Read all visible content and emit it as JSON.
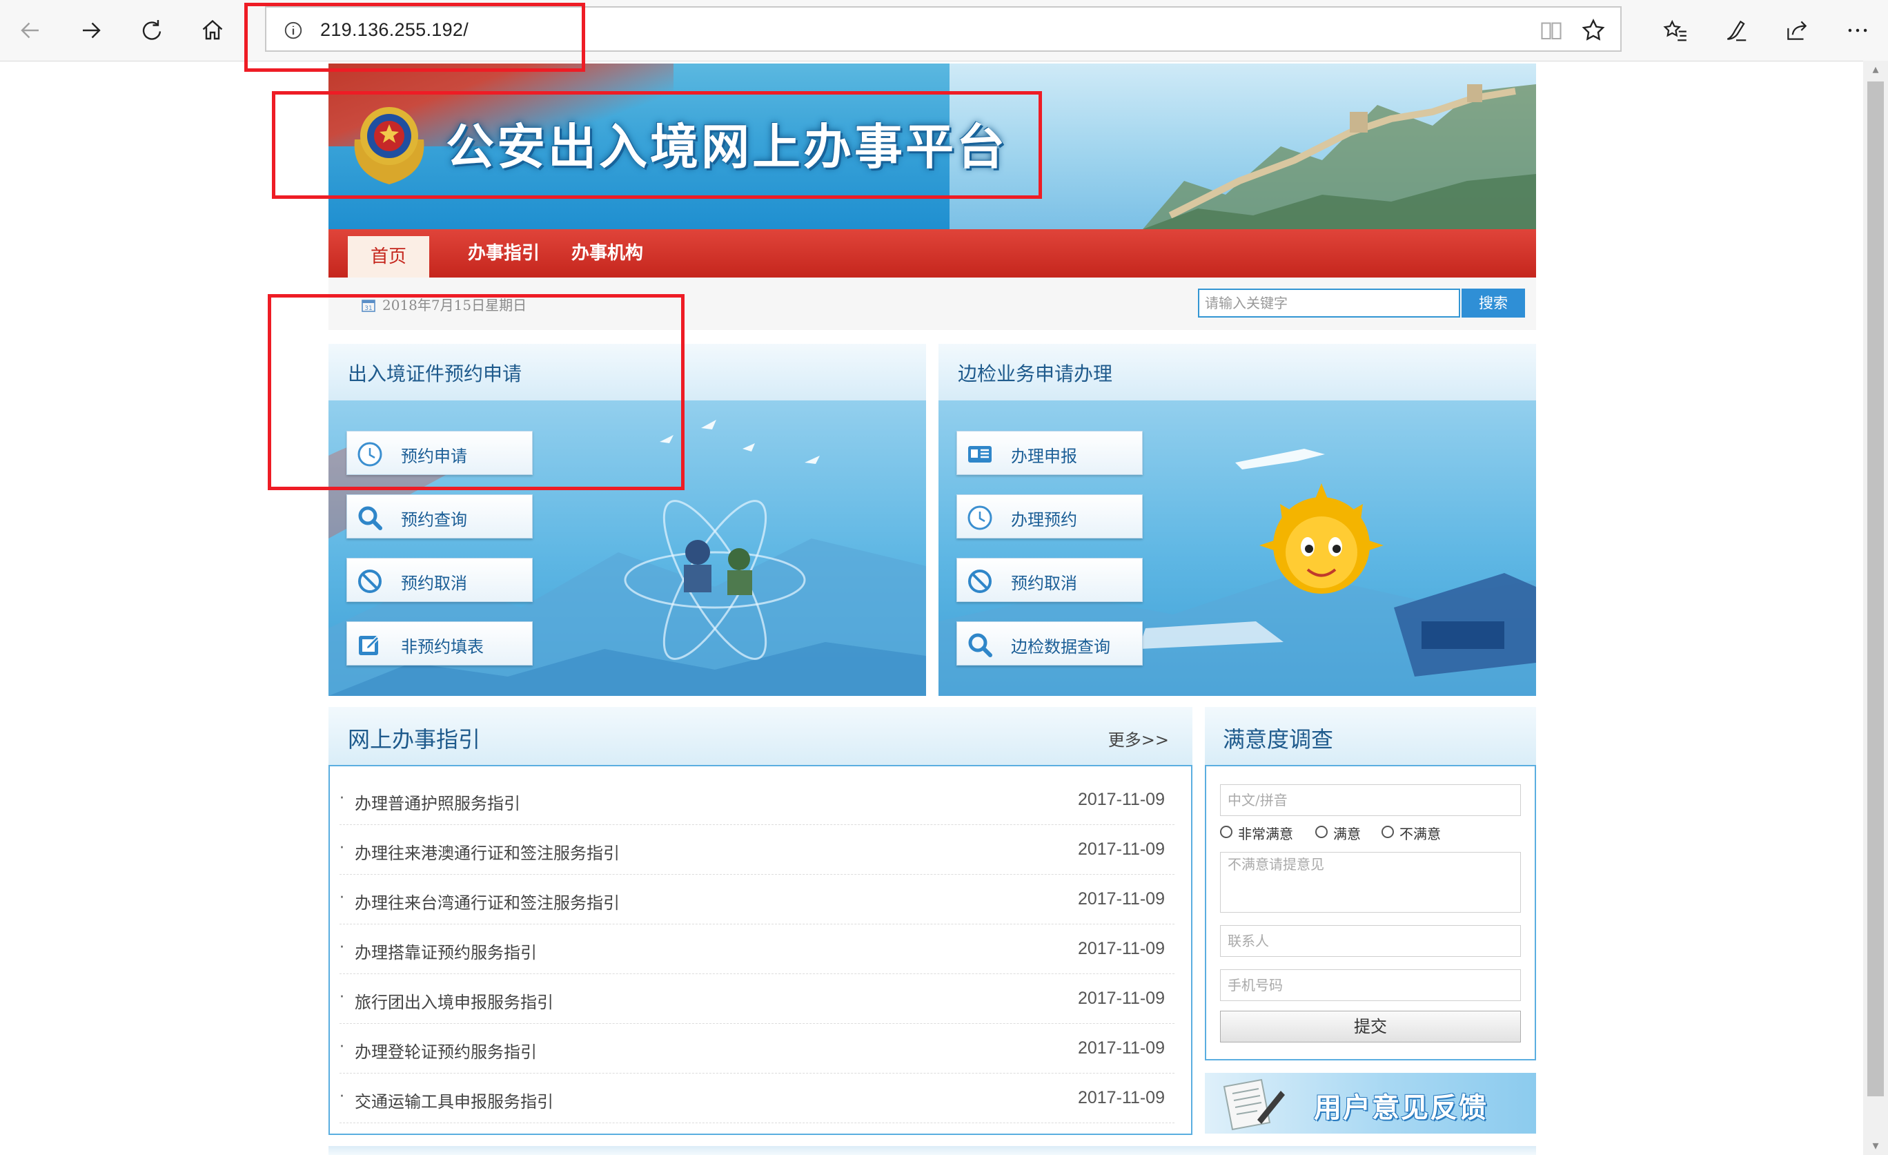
{
  "browser": {
    "url": "219.136.255.192/",
    "icons": [
      "back-icon",
      "forward-icon",
      "refresh-icon",
      "home-icon",
      "info-icon",
      "reading-view-icon",
      "favorite-star-icon",
      "favorites-list-icon",
      "pen-icon",
      "share-icon",
      "more-icon"
    ]
  },
  "banner": {
    "title": "公安出入境网上办事平台"
  },
  "nav": {
    "home": "首页",
    "guide": "办事指引",
    "agency": "办事机构"
  },
  "info": {
    "date": "2018年7月15日星期日",
    "search_placeholder": "请输入关键字",
    "search_button": "搜索"
  },
  "left_panel": {
    "title": "出入境证件预约申请",
    "buttons": [
      {
        "label": "预约申请",
        "icon": "clock-icon"
      },
      {
        "label": "预约查询",
        "icon": "magnifier-icon"
      },
      {
        "label": "预约取消",
        "icon": "cancel-icon"
      },
      {
        "label": "非预约填表",
        "icon": "edit-icon"
      }
    ]
  },
  "right_panel": {
    "title": "边检业务申请办理",
    "buttons": [
      {
        "label": "办理申报",
        "icon": "id-card-icon"
      },
      {
        "label": "办理预约",
        "icon": "clock-icon"
      },
      {
        "label": "预约取消",
        "icon": "cancel-icon"
      },
      {
        "label": "边检数据查询",
        "icon": "magnifier-icon"
      }
    ]
  },
  "guides": {
    "title": "网上办事指引",
    "more": "更多>>",
    "items": [
      {
        "title": "办理普通护照服务指引",
        "date": "2017-11-09"
      },
      {
        "title": "办理往来港澳通行证和签注服务指引",
        "date": "2017-11-09"
      },
      {
        "title": "办理往来台湾通行证和签注服务指引",
        "date": "2017-11-09"
      },
      {
        "title": "办理搭靠证预约服务指引",
        "date": "2017-11-09"
      },
      {
        "title": "旅行团出入境申报服务指引",
        "date": "2017-11-09"
      },
      {
        "title": "办理登轮证预约服务指引",
        "date": "2017-11-09"
      },
      {
        "title": "交通运输工具申报服务指引",
        "date": "2017-11-09"
      }
    ]
  },
  "survey": {
    "title": "满意度调查",
    "name_placeholder": "中文/拼音",
    "options": [
      "非常满意",
      "满意",
      "不满意"
    ],
    "comment_placeholder": "不满意请提意见",
    "contact_placeholder": "联系人",
    "phone_placeholder": "手机号码",
    "submit": "提交"
  },
  "feedback": {
    "label": "用户意见反馈"
  },
  "colors": {
    "red_bar": "#c5261d",
    "accent_blue": "#2f8fd6",
    "title_blue": "#1e5a8c",
    "annotation": "#ee1c25"
  }
}
